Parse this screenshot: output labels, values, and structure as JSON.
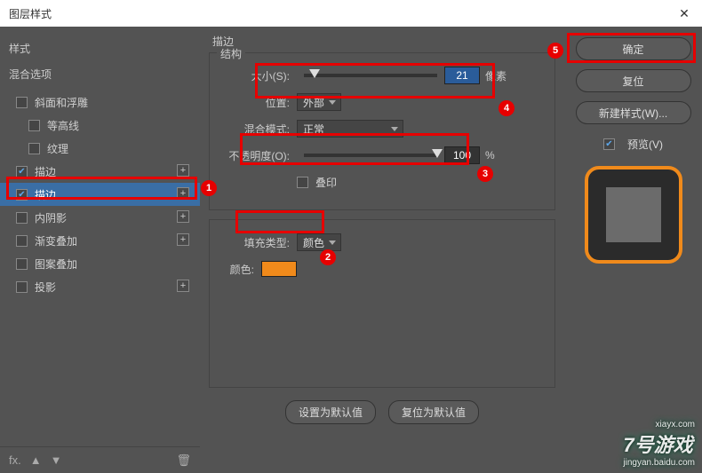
{
  "window": {
    "title": "图层样式",
    "close": "✕"
  },
  "left": {
    "header": "样式",
    "blend": "混合选项",
    "items": [
      {
        "label": "斜面和浮雕",
        "checked": false,
        "plus": false,
        "indent": false
      },
      {
        "label": "等高线",
        "checked": false,
        "plus": false,
        "indent": true
      },
      {
        "label": "纹理",
        "checked": false,
        "plus": false,
        "indent": true
      },
      {
        "label": "描边",
        "checked": true,
        "plus": true,
        "indent": false
      },
      {
        "label": "描边",
        "checked": true,
        "plus": true,
        "indent": false,
        "selected": true
      },
      {
        "label": "内阴影",
        "checked": false,
        "plus": true,
        "indent": false
      },
      {
        "label": "渐变叠加",
        "checked": false,
        "plus": true,
        "indent": false
      },
      {
        "label": "图案叠加",
        "checked": false,
        "plus": false,
        "indent": false
      },
      {
        "label": "投影",
        "checked": false,
        "plus": true,
        "indent": false
      }
    ],
    "footer": {
      "fx": "fx.",
      "up": "▲",
      "down": "▼",
      "trash": "🗑"
    }
  },
  "mid": {
    "group": "描边",
    "struct": "结构",
    "size_label": "大小(S):",
    "size_value": "21",
    "size_unit": "像素",
    "position_label": "位置:",
    "position_value": "外部",
    "blend_label": "混合模式:",
    "blend_value": "正常",
    "opacity_label": "不透明度(O):",
    "opacity_value": "100",
    "opacity_unit": "%",
    "overprint": "叠印",
    "filltype_label": "填充类型:",
    "filltype_value": "颜色",
    "color_label": "颜色:",
    "color_value": "#f08a1b",
    "btn_default": "设置为默认值",
    "btn_reset": "复位为默认值"
  },
  "right": {
    "ok": "确定",
    "cancel": "复位",
    "newstyle": "新建样式(W)...",
    "preview": "预览(V)"
  },
  "badges": {
    "b1": "1",
    "b2": "2",
    "b3": "3",
    "b4": "4",
    "b5": "5"
  },
  "watermark": {
    "site": "xiayx.com",
    "brand": "7号游戏",
    "sub": "jingyan.baidu.com"
  }
}
